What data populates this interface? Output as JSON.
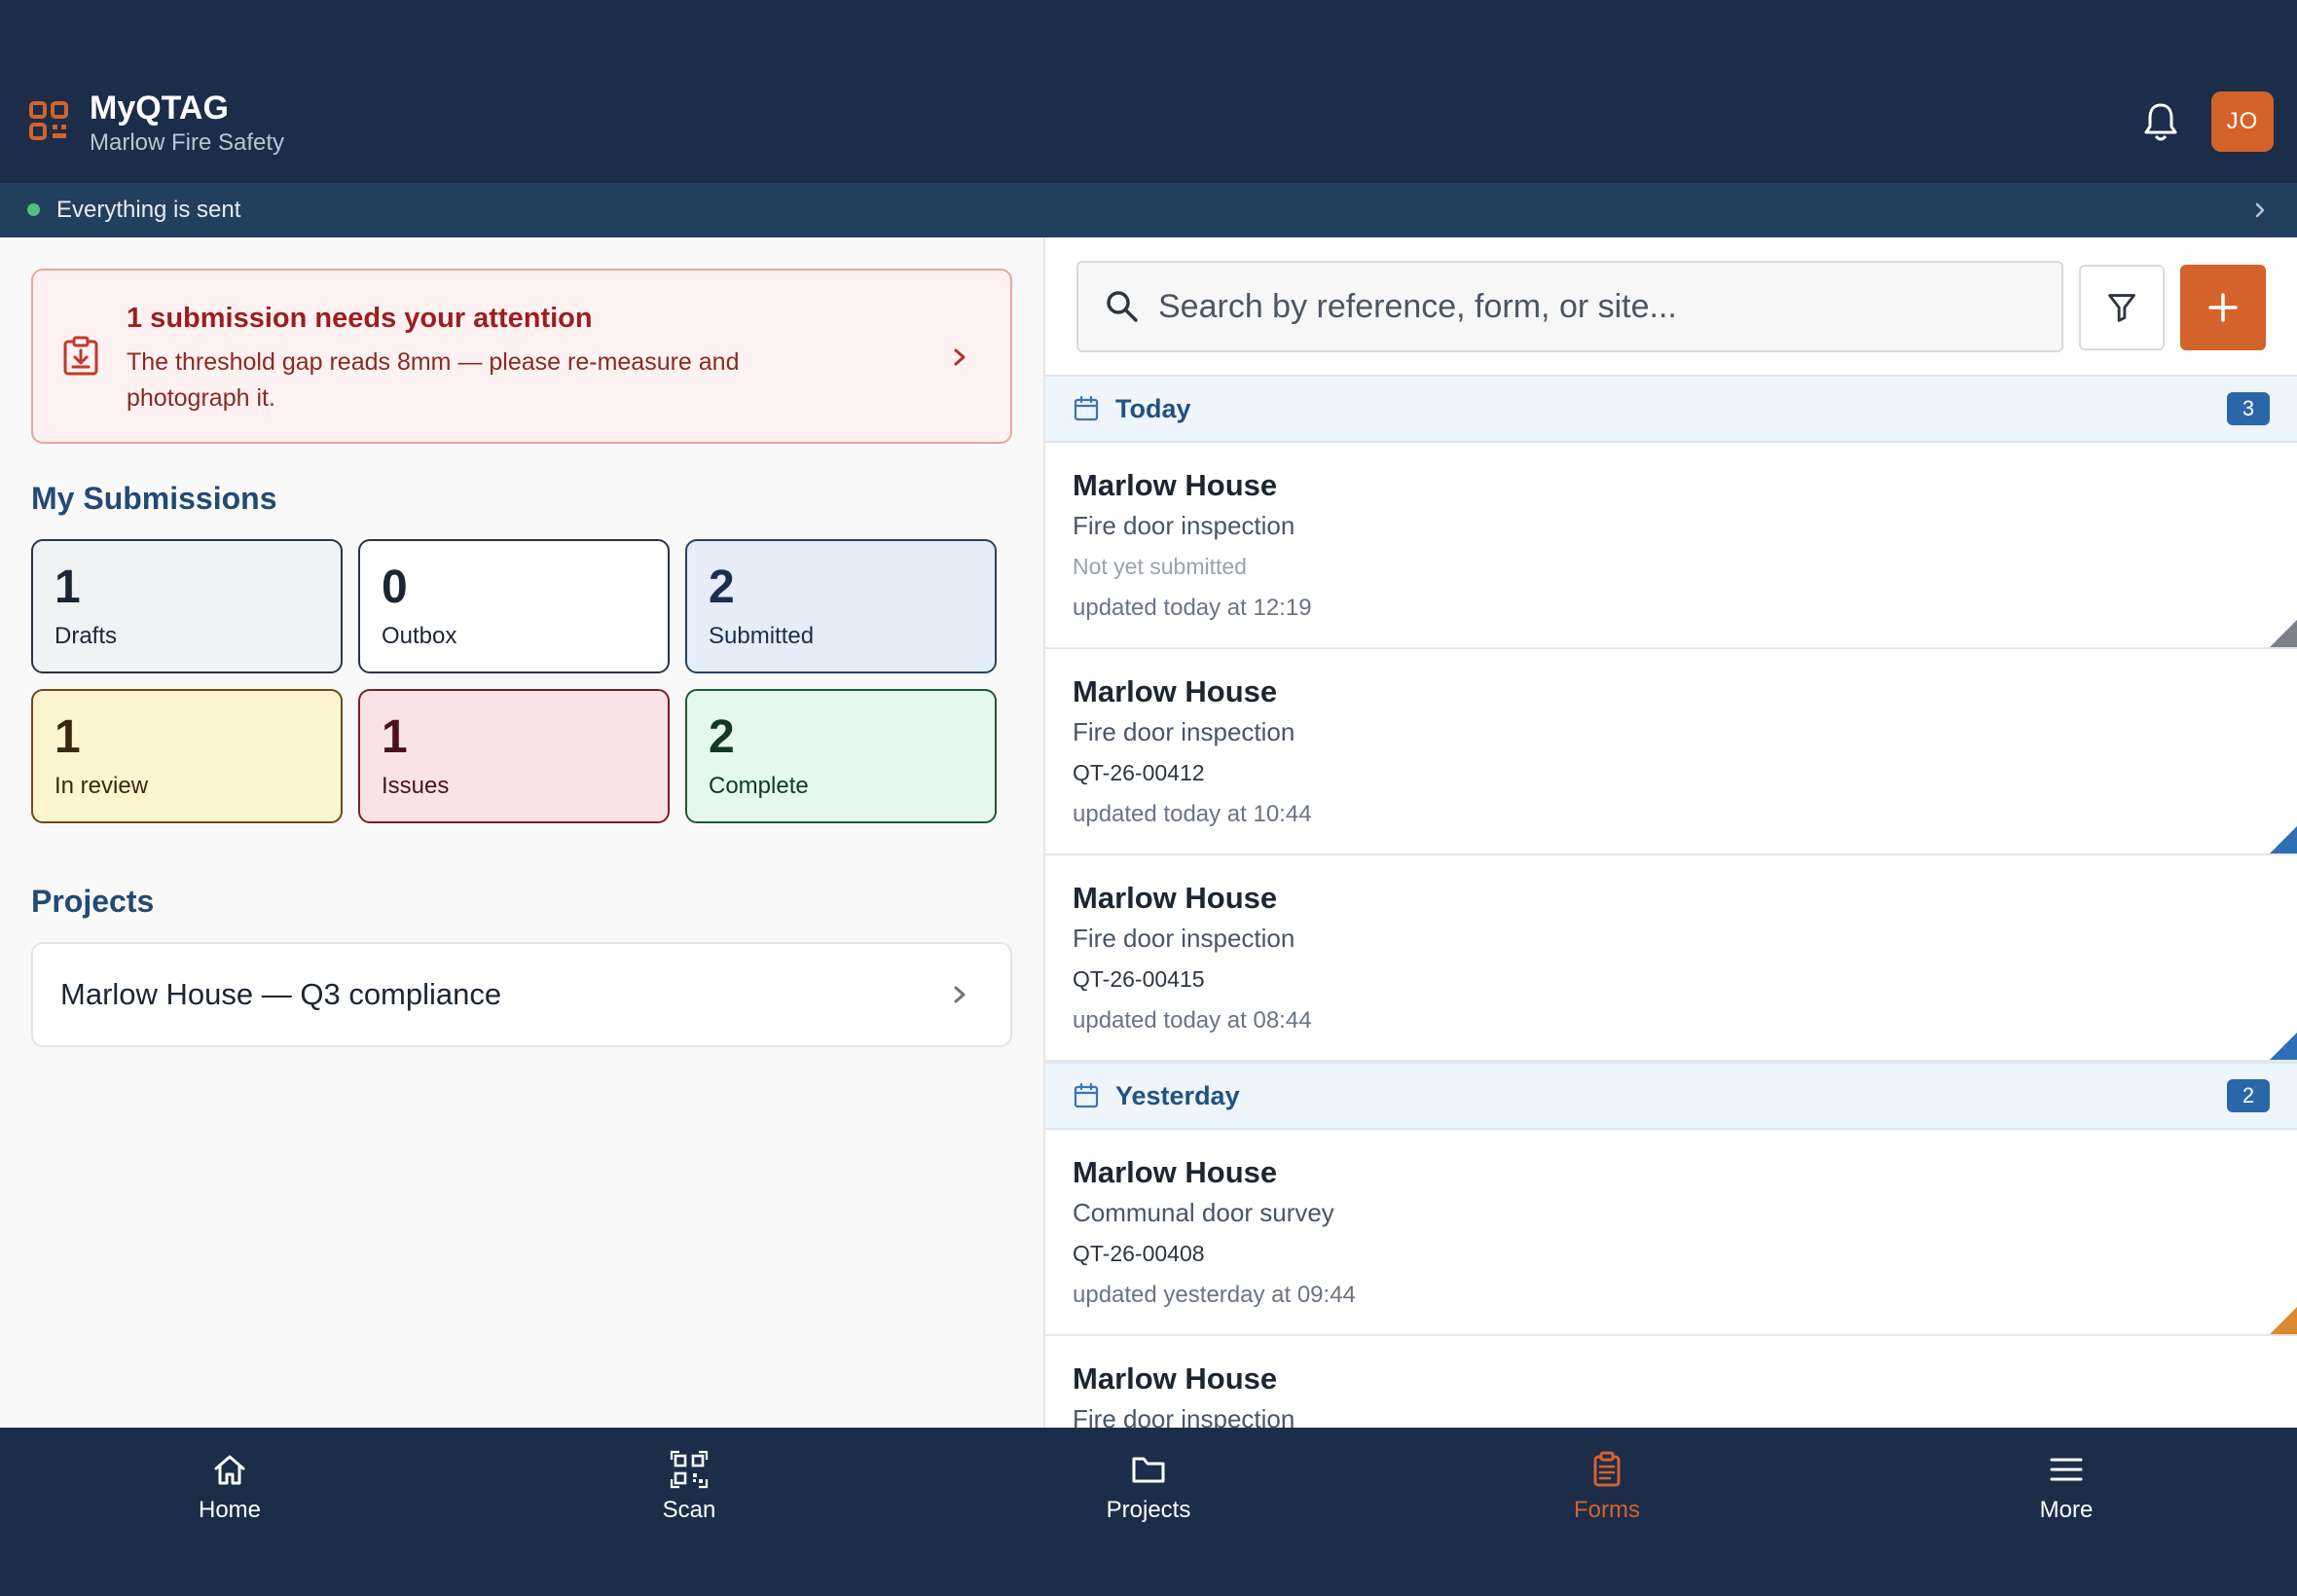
{
  "app": {
    "title": "MyQTAG",
    "organisation": "Marlow Fire Safety",
    "user_initials": "JO",
    "brand_color": "#d4622b"
  },
  "sync_status": {
    "text": "Everything is sent",
    "dot_color": "#4fc27a"
  },
  "alert": {
    "title": "1 submission needs your attention",
    "body": "The threshold gap reads 8mm — please re-measure and photograph it."
  },
  "my_submissions": {
    "title": "My Submissions",
    "stats": [
      {
        "count": "1",
        "label": "Drafts",
        "bg": "#f1f2f4",
        "border": "#2a3444",
        "color": "#1c2633"
      },
      {
        "count": "0",
        "label": "Outbox",
        "bg": "#ffffff",
        "border": "#2a3444",
        "color": "#1c2633"
      },
      {
        "count": "2",
        "label": "Submitted",
        "bg": "#e4edf8",
        "border": "#24436b",
        "color": "#1c2f4a"
      },
      {
        "count": "1",
        "label": "In review",
        "bg": "#fdf5cf",
        "border": "#6e4a1f",
        "color": "#3a2710"
      },
      {
        "count": "1",
        "label": "Issues",
        "bg": "#fae3e5",
        "border": "#7a1f27",
        "color": "#4a1218"
      },
      {
        "count": "2",
        "label": "Complete",
        "bg": "#e4f9ea",
        "border": "#1f5a35",
        "color": "#143922"
      }
    ]
  },
  "projects": {
    "title": "Projects",
    "items": [
      {
        "label": "Marlow House — Q3 compliance"
      }
    ]
  },
  "search": {
    "placeholder": "Search by reference, form, or site..."
  },
  "groups": [
    {
      "label": "Today",
      "count": "3",
      "items": [
        {
          "site": "Marlow House",
          "form": "Fire door inspection",
          "ref": "Not yet submitted",
          "ref_muted": true,
          "updated": "updated today at 12:19",
          "status_color": "#7b8089"
        },
        {
          "site": "Marlow House",
          "form": "Fire door inspection",
          "ref": "QT-26-00412",
          "ref_muted": false,
          "updated": "updated today at 10:44",
          "status_color": "#2e6fb6"
        },
        {
          "site": "Marlow House",
          "form": "Fire door inspection",
          "ref": "QT-26-00415",
          "ref_muted": false,
          "updated": "updated today at 08:44",
          "status_color": "#2e6fb6"
        }
      ]
    },
    {
      "label": "Yesterday",
      "count": "2",
      "items": [
        {
          "site": "Marlow House",
          "form": "Communal door survey",
          "ref": "QT-26-00408",
          "ref_muted": false,
          "updated": "updated yesterday at 09:44",
          "status_color": "#d9892f"
        },
        {
          "site": "Marlow House",
          "form": "Fire door inspection",
          "ref": "",
          "ref_muted": false,
          "updated": "",
          "status_color": "#2e6fb6"
        }
      ]
    }
  ],
  "nav": [
    {
      "label": "Home",
      "icon": "home-icon",
      "active": false
    },
    {
      "label": "Scan",
      "icon": "qr-scan-icon",
      "active": false
    },
    {
      "label": "Projects",
      "icon": "folder-icon",
      "active": false
    },
    {
      "label": "Forms",
      "icon": "clipboard-icon",
      "active": true
    },
    {
      "label": "More",
      "icon": "menu-icon",
      "active": false
    }
  ]
}
